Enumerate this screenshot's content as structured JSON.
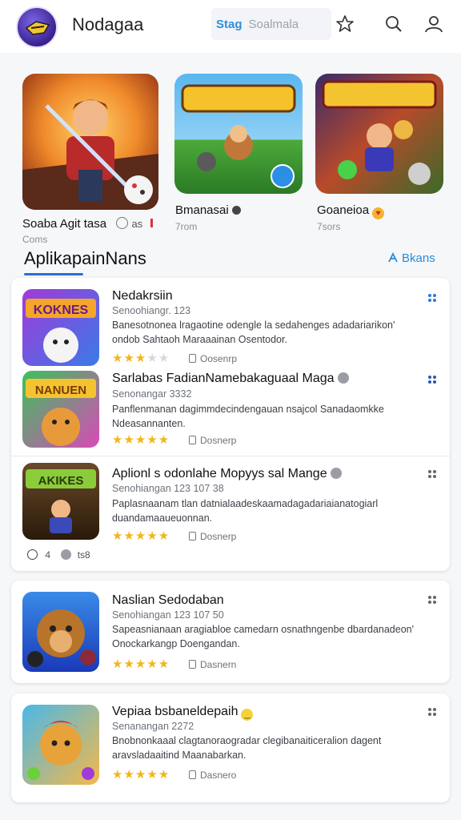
{
  "header": {
    "app_name": "Nodagaa",
    "search_tag": "Stag",
    "search_placeholder": "Soalmala"
  },
  "featured": [
    {
      "title": "Soaba Agit tasa",
      "sub": "Coms",
      "extra": "as"
    },
    {
      "title": "Bmanasai",
      "sub": "7rom"
    },
    {
      "title": "Goaneioa",
      "sub": "7sors"
    }
  ],
  "section": {
    "title": "AplikapainNans",
    "link": "Bkans"
  },
  "items": [
    {
      "title": "Nedakrsiin",
      "meta": "Senoohiangr. 123",
      "desc": "Banesotnonea lragaotine odengle la sedahenges adadariarikon' ondob Sahtaoh Maraaainan Osentodor.",
      "rating": 3,
      "downloads": "Oosenrp",
      "art_text": "KOKNES"
    },
    {
      "title": "Sarlabas FadianNamebakaguaal Maga",
      "meta": "Senonangar 3332",
      "desc": "Panflenmanan dagimmdecindengauan nsajcol Sanadaomkke Ndeasannanten.",
      "rating": 5,
      "downloads": "Dosnerp",
      "art_text": "NANUEN"
    },
    {
      "title": "Aplionl s odonlahe Mopyys sal Mange",
      "meta": "Senohiangan 123 107 38",
      "desc": "Paplasnaanam tlan datnialaadeskaamadagadariaianatogiarl duandamaaueuonnan.",
      "rating": 5,
      "downloads": "Dosnerp",
      "art_text": "AKIKES",
      "footer_count": "4",
      "footer_label": "ts8"
    },
    {
      "title": "Naslian Sedodaban",
      "meta": "Senohiangan 123 107 50",
      "desc": "Sapeasnianaan aragiabloe camedarn osnathngenbe dbardanadeon' Onockarkangp Doengandan.",
      "rating": 5,
      "downloads": "Dasnern"
    },
    {
      "title": "Vepiaa bsbaneldepaih",
      "meta": "Senanangan 2272",
      "desc": "Bnobnonkaaal clagtanoraogradar clegibanaiticeralion dagent aravsladaaitind Maanabarkan.",
      "rating": 5,
      "downloads": "Dasnero"
    }
  ],
  "colors": {
    "accent": "#2d6fd3",
    "star": "#f2b619"
  }
}
